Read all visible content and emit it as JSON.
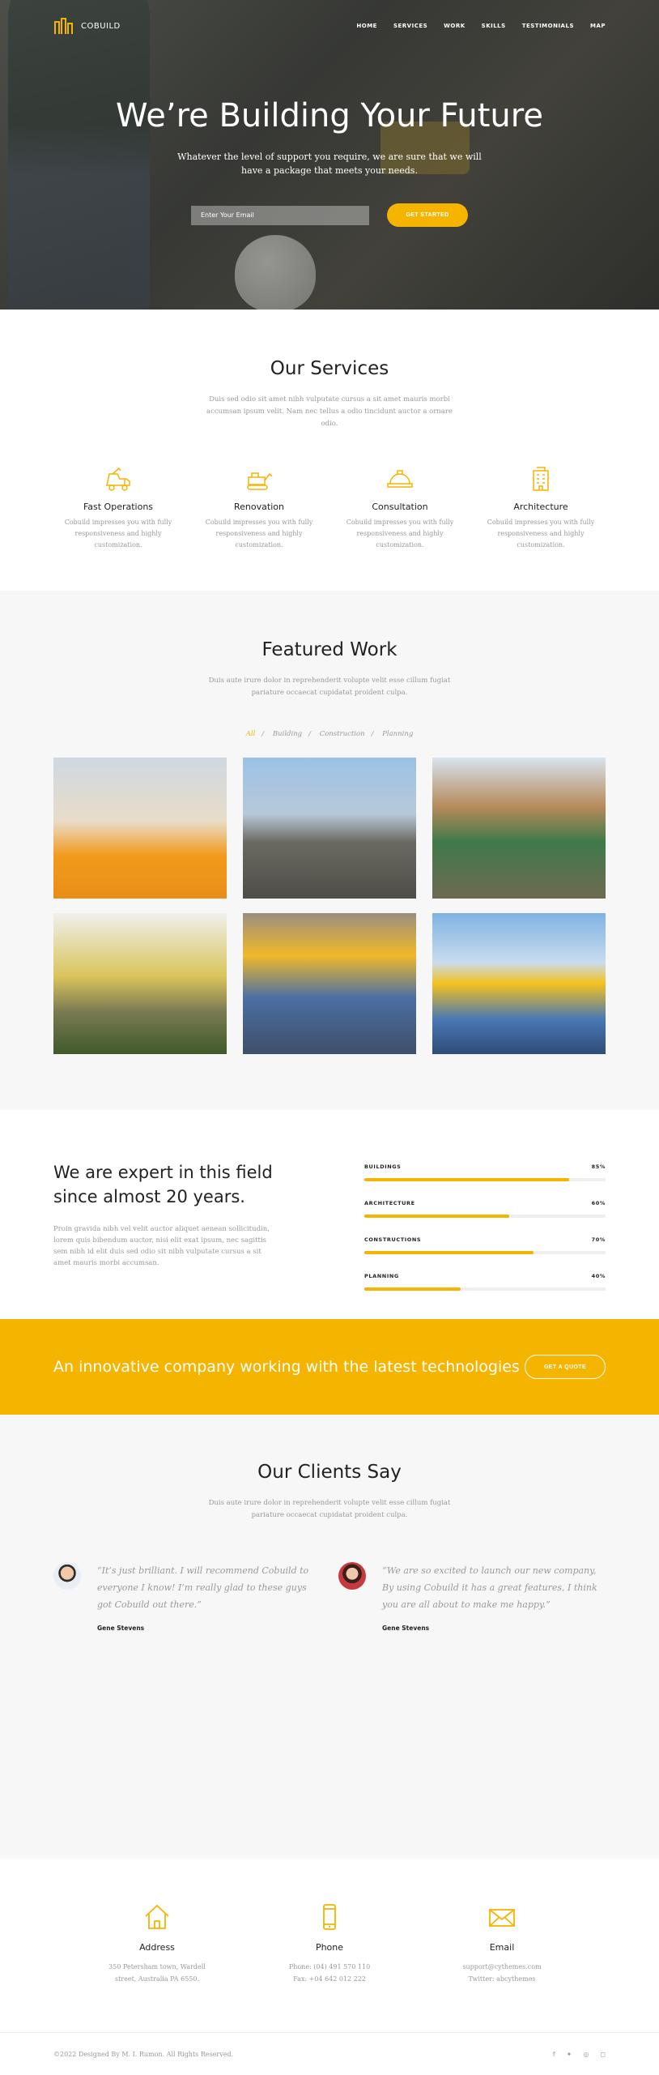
{
  "brand": {
    "name": "COBUILD"
  },
  "nav": [
    "HOME",
    "SERVICES",
    "WORK",
    "SKILLS",
    "TESTIMONIALS",
    "MAP"
  ],
  "hero": {
    "title": "We’re Building Your Future",
    "lead_line1": "Whatever the level of support you require, we are sure that we will",
    "lead_line2": "have a package that meets your needs.",
    "email_placeholder": "Enter Your Email",
    "cta": "GET STARTED"
  },
  "services": {
    "title": "Our Services",
    "subtitle": "Duis sed odio sit amet nibh vulputate cursus a sit amet mauris morbi accumsan ipsum velit. Nam nec tellus a odio tincidunt auctor a ornare odio.",
    "items": [
      {
        "title": "Fast Operations",
        "text": "Cobuild impresses you with fully responsiveness and highly customization."
      },
      {
        "title": "Renovation",
        "text": "Cobuild impresses you with fully responsiveness and highly customization."
      },
      {
        "title": "Consultation",
        "text": "Cobuild impresses you with fully responsiveness and highly customization."
      },
      {
        "title": "Architecture",
        "text": "Cobuild impresses you with fully responsiveness and highly customization."
      }
    ]
  },
  "work": {
    "title": "Featured Work",
    "subtitle": "Duis aute irure dolor in reprehenderit volupte velit esse cillum fugiat pariature occaecat cupidatat proident culpa.",
    "filters": [
      "All",
      "Building",
      "Construction",
      "Planning"
    ],
    "active_filter": "All"
  },
  "skills": {
    "title": "We are expert in this field since almost 20 years.",
    "text": "Proin gravida nibh vel velit auctor aliquet aenean sollicitudin, lorem quis bibendum auctor, nisi elit exat ipsum, nec sagittis sem nibh id elit duis sed odio sit nibh vulputate cursus a sit amet mauris morbi accumsan.",
    "bars": [
      {
        "label": "BUILDINGS",
        "value": "85%",
        "fraction": 0.85
      },
      {
        "label": "ARCHITECTURE",
        "value": "60%",
        "fraction": 0.6
      },
      {
        "label": "CONSTRUCTIONS",
        "value": "70%",
        "fraction": 0.7
      },
      {
        "label": "PLANNING",
        "value": "40%",
        "fraction": 0.4
      }
    ]
  },
  "banner": {
    "text": "An innovative company working with the latest technologies",
    "cta": "GET A QUOTE"
  },
  "testimonials": {
    "title": "Our Clients Say",
    "subtitle": "Duis aute irure dolor in reprehenderit volupte velit esse cillum fugiat pariature occaecat cupidatat proident culpa.",
    "items": [
      {
        "quote": "“It’s just brilliant. I will recommend Cobuild to everyone I know! I’m really glad to these guys got Cobuild out there.”",
        "name": "Gene Stevens"
      },
      {
        "quote": "“We are so excited to launch our new company, By using Cobuild it has a great features, I think you are all about to make me happy.”",
        "name": "Gene Stevens"
      }
    ]
  },
  "contact": [
    {
      "title": "Address",
      "line1": "350 Petersham town, Wardell",
      "line2": "street, Australia PA 6550."
    },
    {
      "title": "Phone",
      "line1": "Phone: (04) 491 570 110",
      "line2": "Fax: +04 642 012 222"
    },
    {
      "title": "Email",
      "line1": "support@cythemes.com",
      "line2": "Twitter: abcythemes"
    }
  ],
  "footer": {
    "copyright": "©2022 Designed By M. I. Rumon. All Rights Reserved."
  },
  "colors": {
    "accent": "#f5b400"
  }
}
